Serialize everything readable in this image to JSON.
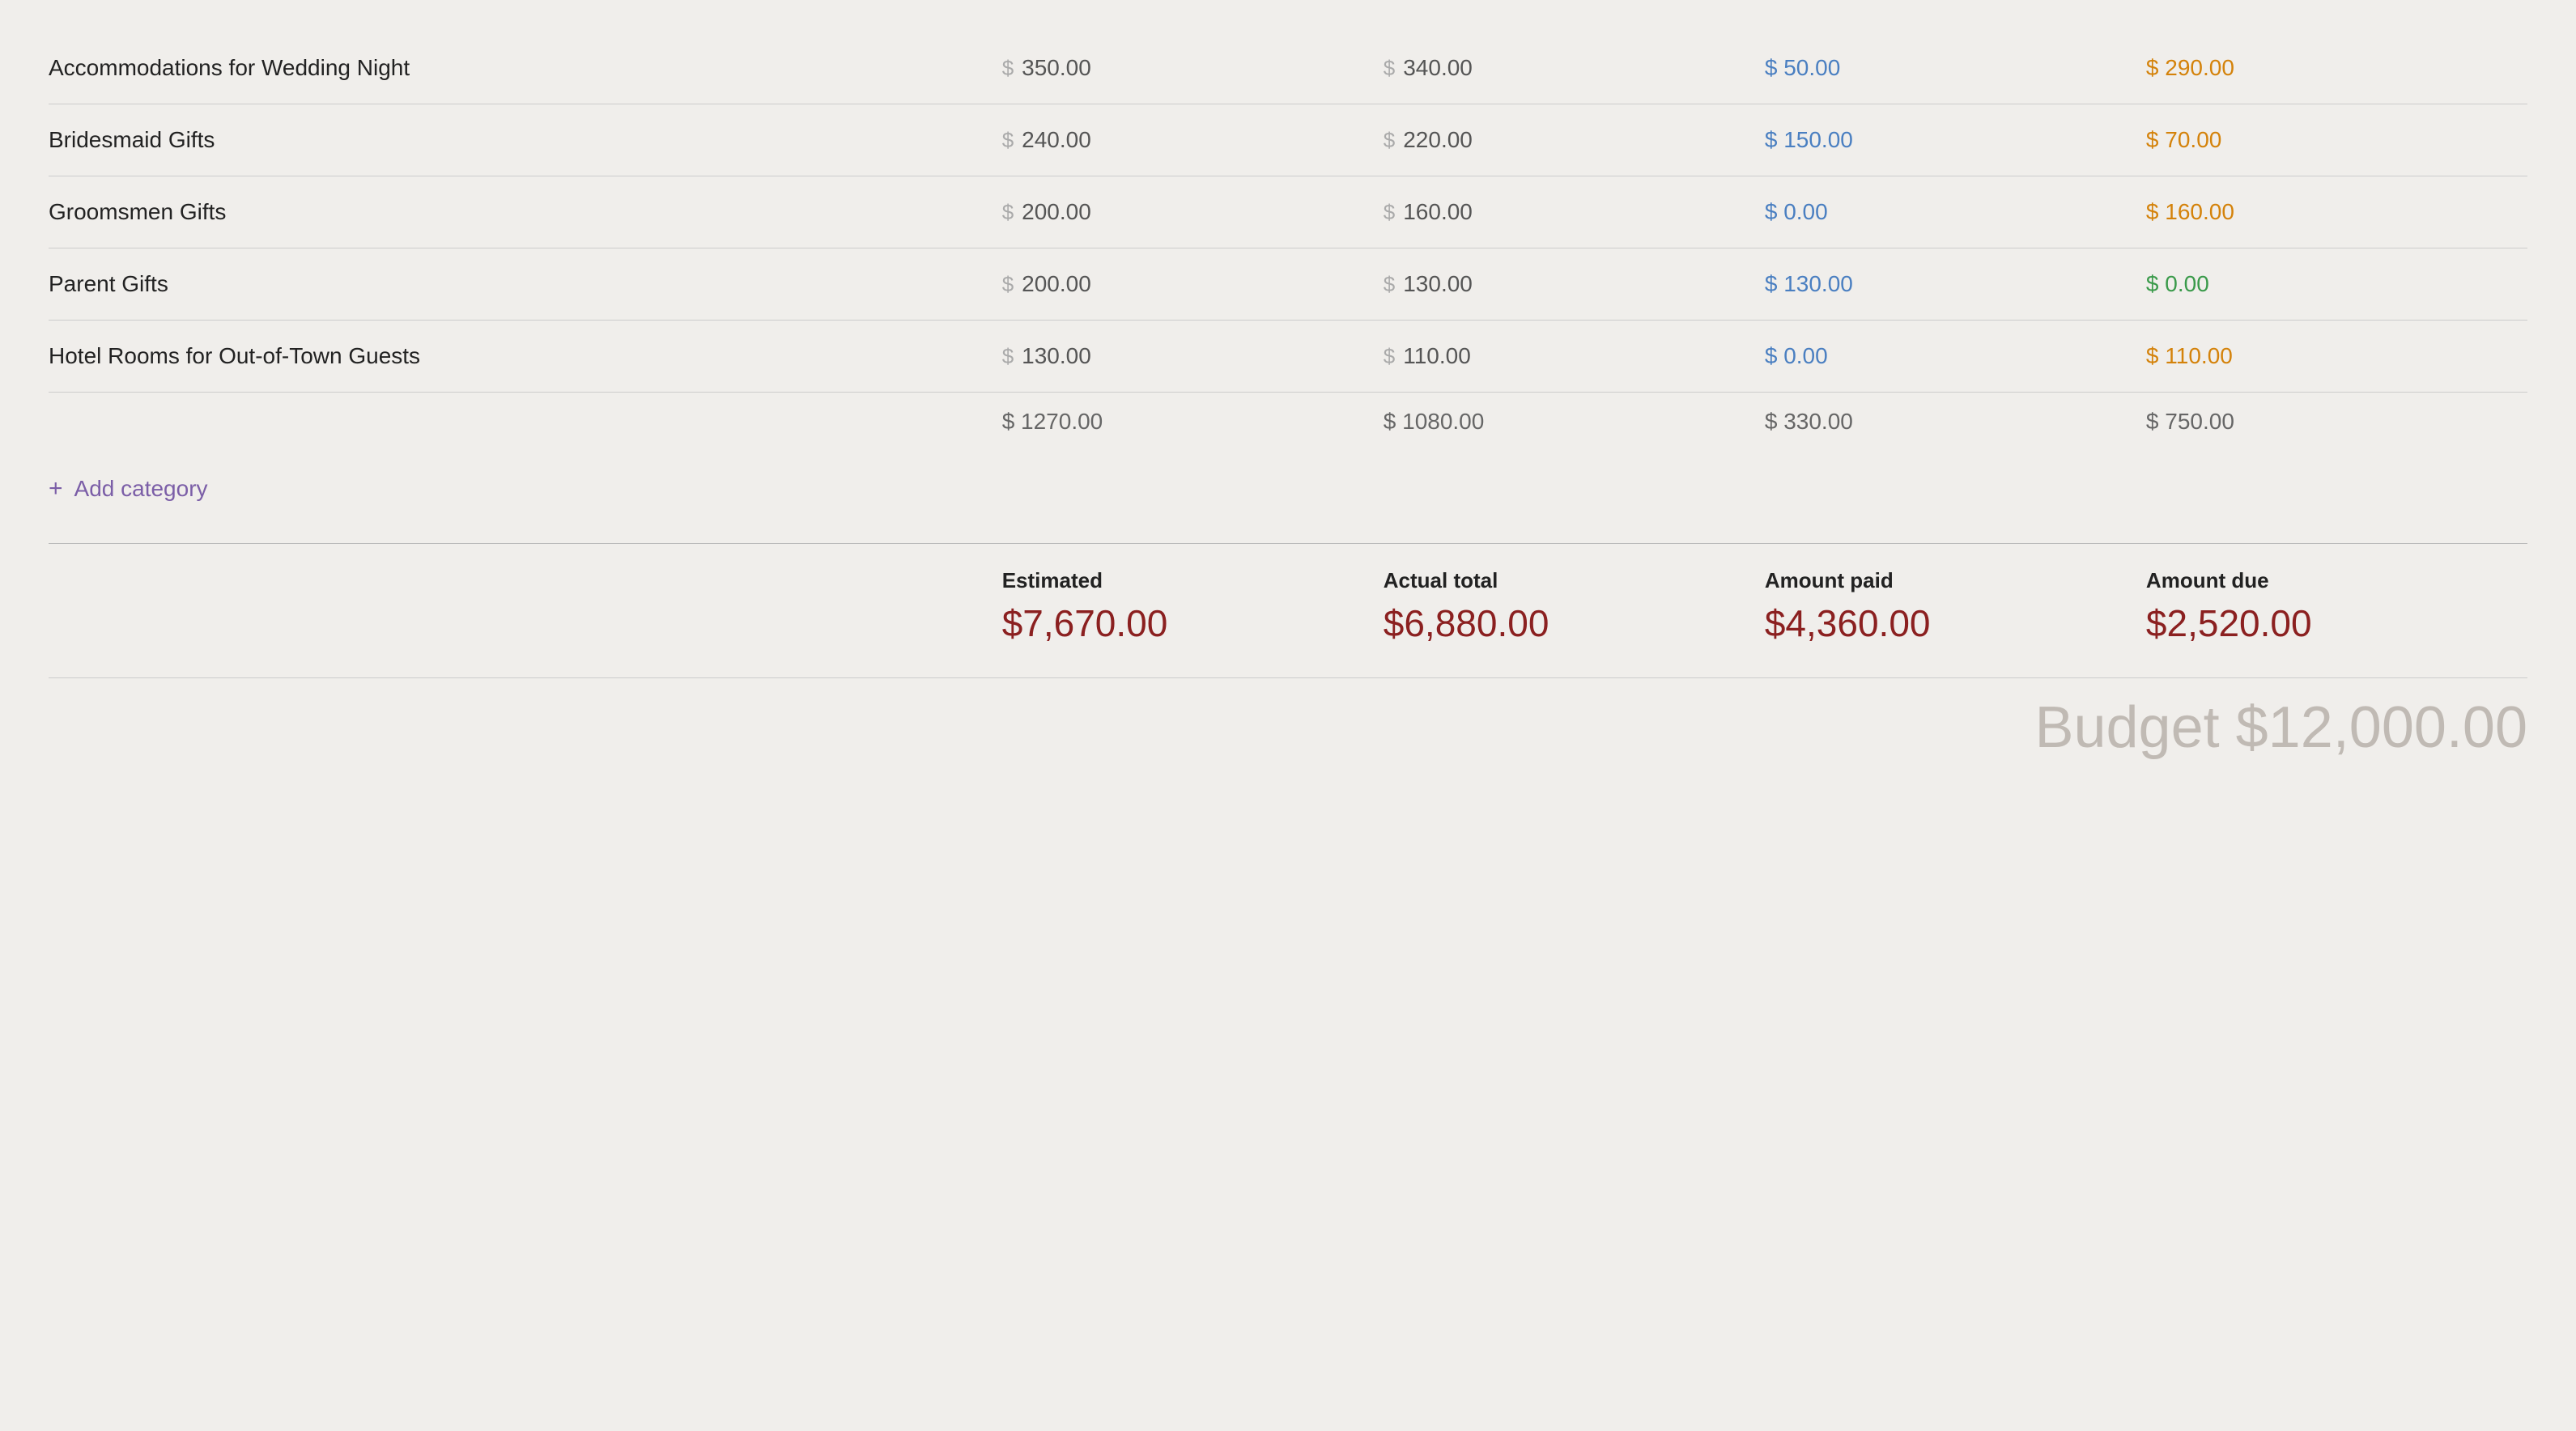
{
  "rows": [
    {
      "name": "Accommodations for Wedding Night",
      "estimated": "350.00",
      "actual": "340.00",
      "paid": "50.00",
      "due": "290.00",
      "paid_color": "blue",
      "due_color": "orange"
    },
    {
      "name": "Bridesmaid Gifts",
      "estimated": "240.00",
      "actual": "220.00",
      "paid": "150.00",
      "due": "70.00",
      "paid_color": "blue",
      "due_color": "orange"
    },
    {
      "name": "Groomsmen Gifts",
      "estimated": "200.00",
      "actual": "160.00",
      "paid": "0.00",
      "due": "160.00",
      "paid_color": "blue",
      "due_color": "orange"
    },
    {
      "name": "Parent Gifts",
      "estimated": "200.00",
      "actual": "130.00",
      "paid": "130.00",
      "due": "0.00",
      "paid_color": "blue",
      "due_color": "green"
    },
    {
      "name": "Hotel Rooms for Out-of-Town Guests",
      "estimated": "130.00",
      "actual": "110.00",
      "paid": "0.00",
      "due": "110.00",
      "paid_color": "blue",
      "due_color": "orange"
    }
  ],
  "subtotals": {
    "estimated": "$ 1270.00",
    "actual": "$ 1080.00",
    "paid": "$ 330.00",
    "due": "$ 750.00"
  },
  "add_category_label": "Add category",
  "summary": {
    "estimated_label": "Estimated",
    "estimated_value": "$7,670.00",
    "actual_label": "Actual total",
    "actual_value": "$6,880.00",
    "paid_label": "Amount paid",
    "paid_value": "$4,360.00",
    "due_label": "Amount due",
    "due_value": "$2,520.00"
  },
  "budget_label": "Budget $12,000.00"
}
